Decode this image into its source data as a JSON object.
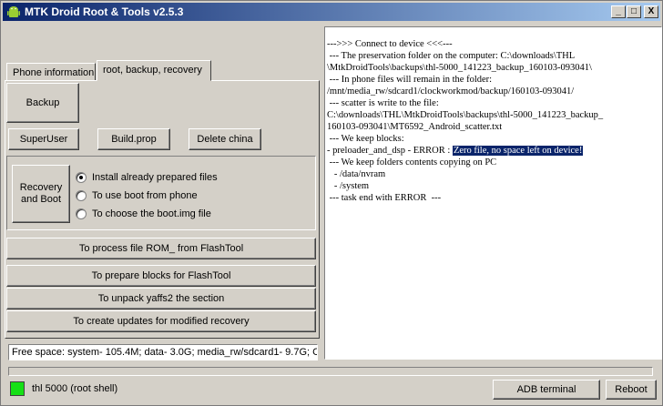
{
  "window": {
    "title": "MTK Droid Root & Tools v2.5.3",
    "minimize": "_",
    "maximize": "□",
    "close": "X"
  },
  "tabs": [
    {
      "label": "Phone information"
    },
    {
      "label": "root, backup, recovery"
    }
  ],
  "buttons": {
    "backup": "Backup",
    "superuser": "SuperUser",
    "build_prop": "Build.prop",
    "delete_china": "Delete china",
    "recovery_and_boot": "Recovery and Boot",
    "process_rom": "To process file ROM_ from FlashTool",
    "prepare_blocks": "To prepare blocks for FlashTool",
    "unpack_yaffs2": "To unpack yaffs2 the section",
    "create_updates": "To create updates for modified recovery",
    "adb_terminal": "ADB terminal",
    "reboot": "Reboot"
  },
  "radio_options": [
    {
      "label": "Install already prepared files",
      "checked": true
    },
    {
      "label": "To use boot from phone",
      "checked": false
    },
    {
      "label": "To choose the boot.img file",
      "checked": false
    }
  ],
  "log": {
    "lines": [
      "--->>> Connect to device <<<---",
      " --- The preservation folder on the computer: C:\\downloads\\THL",
      "\\MtkDroidTools\\backups\\thl-5000_141223_backup_160103-093041\\",
      " --- In phone files will remain in the folder:",
      "/mnt/media_rw/sdcard1/clockworkmod/backup/160103-093041/",
      " --- scatter is write to the file:",
      "C:\\downloads\\THL\\MtkDroidTools\\backups\\thl-5000_141223_backup_",
      "160103-093041\\MT6592_Android_scatter.txt",
      " --- We keep blocks:"
    ],
    "error_prefix": "- preloader_and_dsp - ERROR : ",
    "error_highlight": "Zero file, no space left on device!",
    "lines_after": [
      " --- We keep folders contents copying on PC",
      "   - /data/nvram",
      "   - /system",
      " --- task end with ERROR  ---"
    ]
  },
  "status": {
    "free_space": "Free space: system- 105.4M; data- 3.0G; media_rw/sdcard1- 9.7G;  C:\\",
    "device": "thl 5000 (root shell)"
  },
  "colors": {
    "device_indicator": "#16e016",
    "highlight": "#0a246a"
  }
}
